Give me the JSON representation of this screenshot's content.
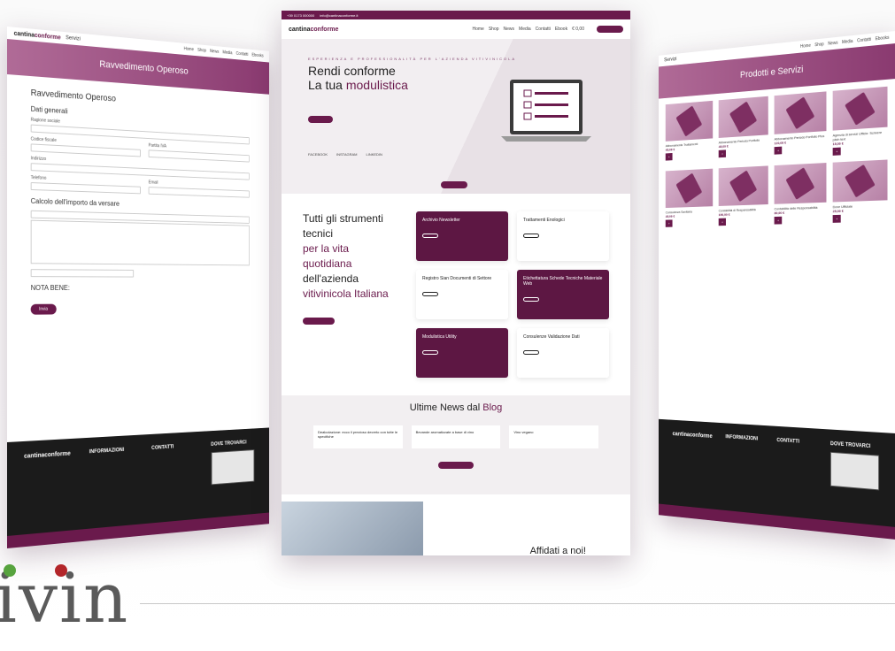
{
  "colors": {
    "brand": "#6a1a4c",
    "accent_light": "#b06b97",
    "dot_green": "#57a33e",
    "dot_red": "#b3262a"
  },
  "brand": {
    "name_prefix": "cantina",
    "name_suffix": "conforme"
  },
  "left_page": {
    "servizi": "Servizi",
    "nav": [
      "Home",
      "Shop",
      "News",
      "Media",
      "Contatti",
      "Ebooks"
    ],
    "banner_title": "Ravvedimento Operoso",
    "form_title": "Ravvedimento Operoso",
    "section_general": "Dati generali",
    "fields": [
      "Ragione sociale",
      "Codice fiscale",
      "Partita IVA",
      "Indirizzo",
      "Telefono",
      "Email"
    ],
    "section_calc": "Calcolo dell'importo da versare",
    "note_title": "NOTA BENE:",
    "submit": "Invia",
    "footer_info": "INFORMAZIONI",
    "footer_contatti": "CONTATTI",
    "footer_dove": "DOVE TROVARCI"
  },
  "center_page": {
    "phone": "+39 0173 000000",
    "email": "info@cantinaconforme.it",
    "nav": [
      "Home",
      "Shop",
      "News",
      "Media",
      "Contatti",
      "Ebook",
      "€ 0,00"
    ],
    "hero_kicker": "ESPERIENZA E PROFESSIONALITÀ PER L'AZIENDA VITIVINICOLA",
    "hero_title_1": "Rendi conforme",
    "hero_title_2a": "La tua ",
    "hero_title_2b": "modulistica",
    "social": [
      "FACEBOOK",
      "INSTAGRAM",
      "LINKEDIN"
    ],
    "tagline_1": "Tutti gli strumenti tecnici",
    "tagline_2": "per la vita quotidiana",
    "tagline_3": "dell'azienda",
    "tagline_4": "vitivinicola Italiana",
    "cards": [
      {
        "title": "Archivio Newsletter",
        "dark": true
      },
      {
        "title": "Trattamenti Enologici",
        "dark": false
      },
      {
        "title": "Registro Sian Documenti di Settore",
        "dark": false
      },
      {
        "title": "Etichettatura Schede Tecniche Materiale Web",
        "dark": true
      },
      {
        "title": "Modulistica Utility",
        "dark": true
      },
      {
        "title": "Consulenze Validazione Dati",
        "dark": false
      }
    ],
    "blog_title_a": "Ultime News dal ",
    "blog_title_b": "Blog",
    "posts": [
      "Dealcolazione: ecco il prezioso decreto con tutte le specifiche",
      "Bevande aromatizzate a base di vino",
      "Vino vegano"
    ],
    "affidati": "Affidati a noi!"
  },
  "right_page": {
    "servizi": "Servizi",
    "nav": [
      "Home",
      "Shop",
      "News",
      "Media",
      "Contatti",
      "Ebooks"
    ],
    "banner_title": "Prodotti e Servizi",
    "products": [
      {
        "name": "Abbonamento Trattamenti",
        "price": "45,00 €"
      },
      {
        "name": "Abbonamento Periodo Portfolio",
        "price": "45,00 €"
      },
      {
        "name": "Abbonamento Periodo Portfolio Plus",
        "price": "120,00 €"
      },
      {
        "name": "Agenzia di servizi Ufficio: Scrivere pitch text",
        "price": "15,00 €"
      },
      {
        "name": "Consulenza Sanitaria",
        "price": "45,00 €"
      },
      {
        "name": "Contabilità di Responsabilità",
        "price": "150,00 €"
      },
      {
        "name": "Contabilità delle Responsabilità",
        "price": "80,00 €"
      },
      {
        "name": "Dove Ufficiale",
        "price": "25,00 €"
      }
    ],
    "footer_info": "INFORMAZIONI",
    "footer_contatti": "CONTATTI",
    "footer_dove": "DOVE TROVARCI"
  },
  "watermark": "ivin"
}
